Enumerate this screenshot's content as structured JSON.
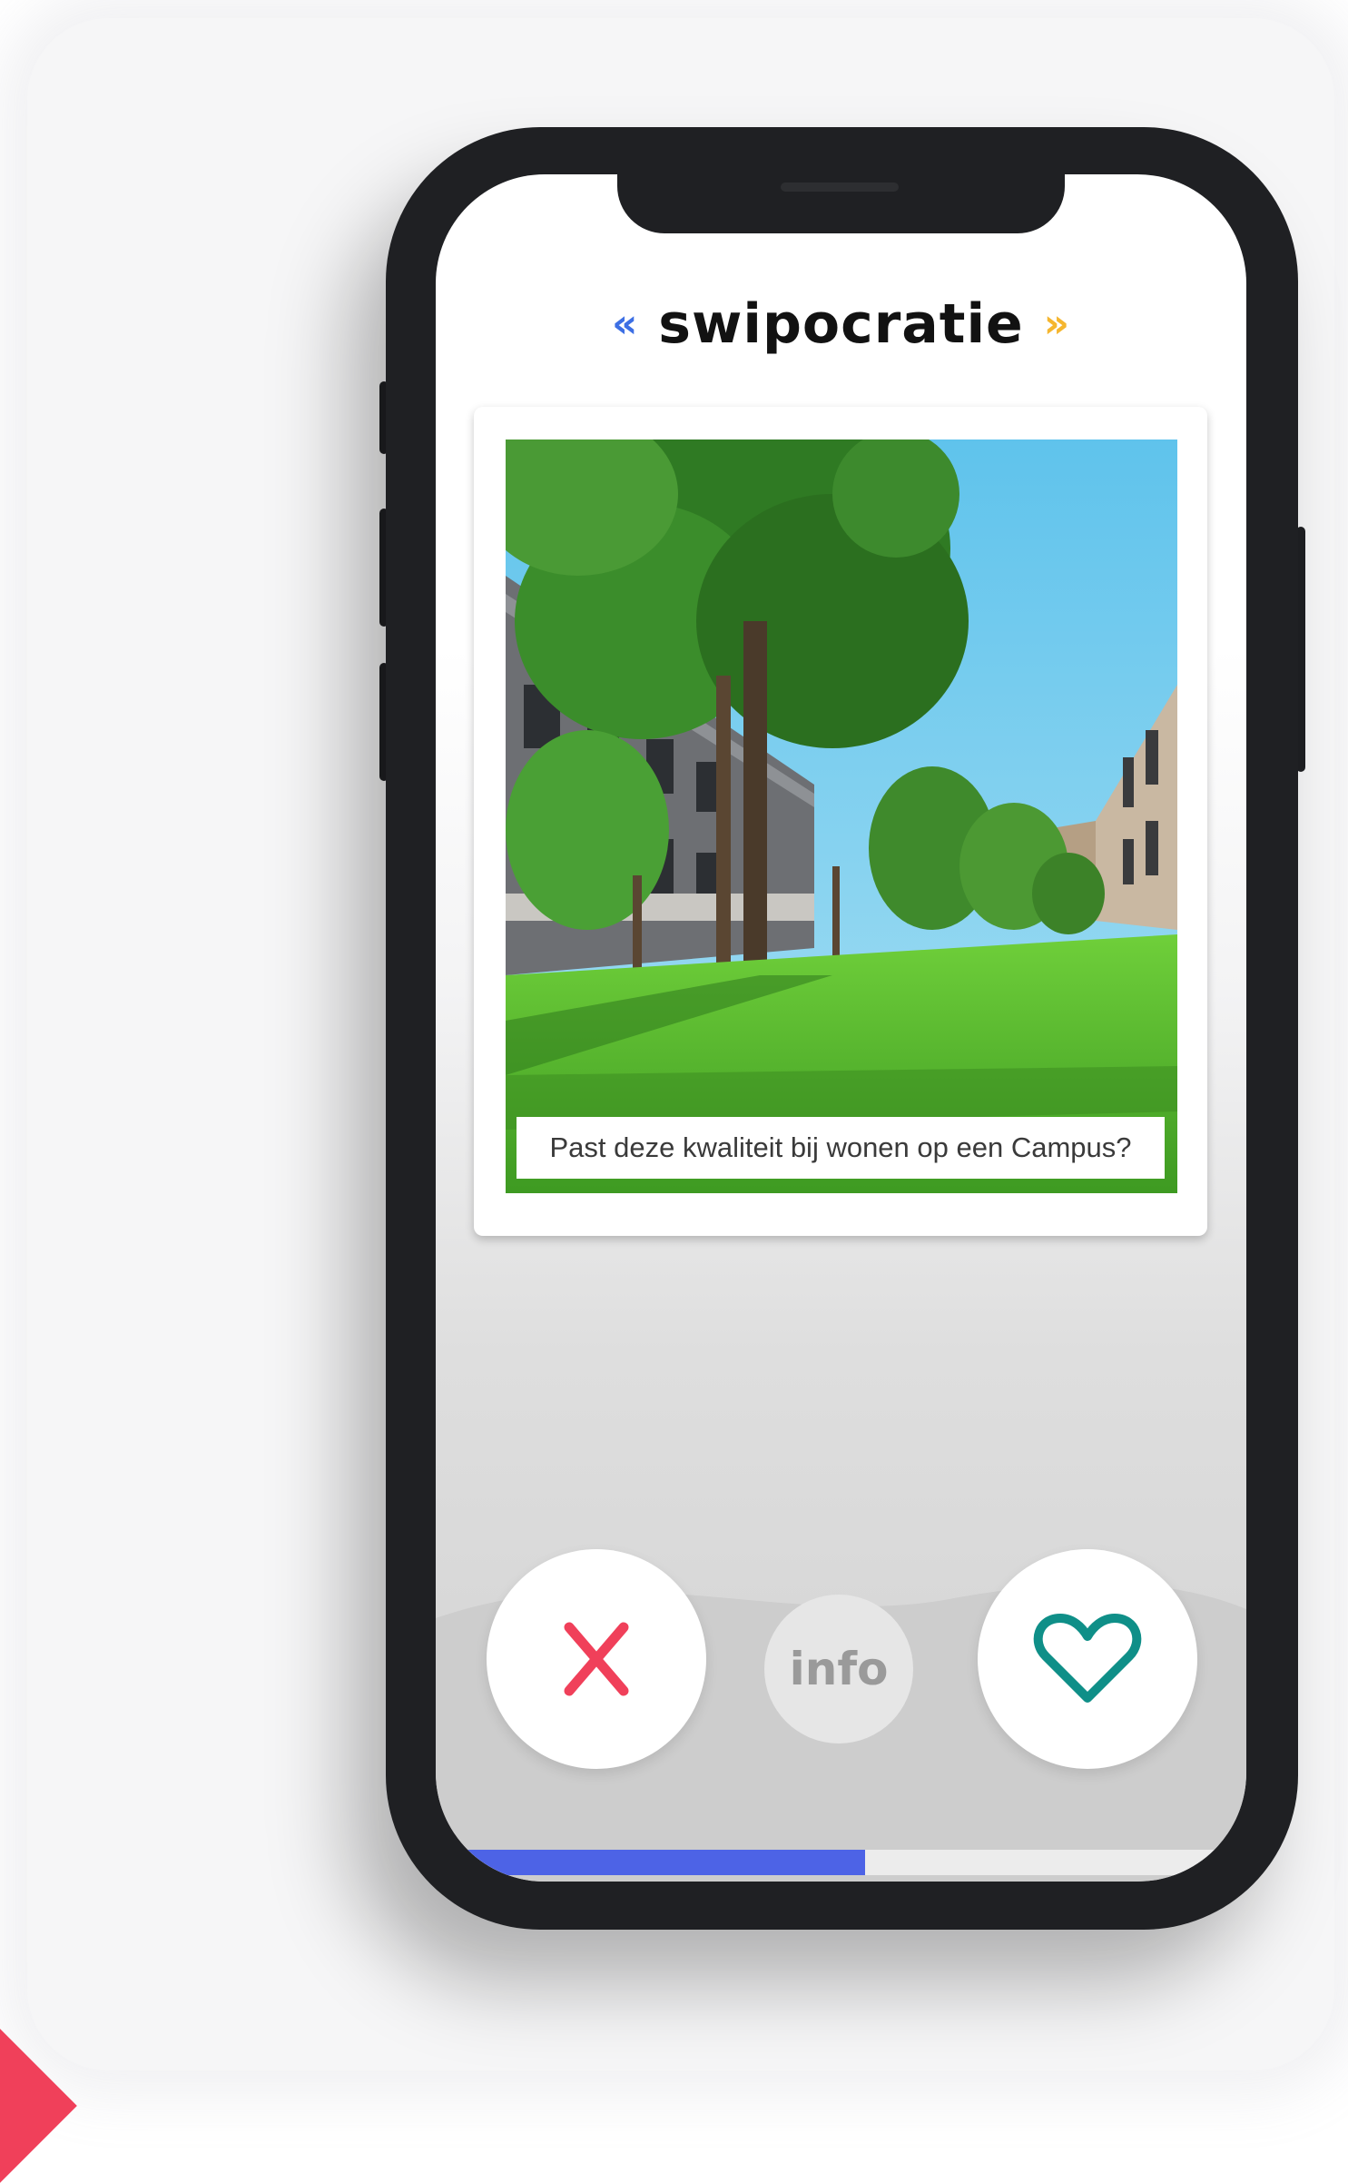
{
  "app": {
    "title": "swipocratie",
    "quote_left": "«",
    "quote_right": "»",
    "quote_left_color": "#3d6fe4",
    "quote_right_color": "#f5b62f"
  },
  "card": {
    "image": "campus-lawn-trees-photo",
    "caption": "Past deze kwaliteit bij wonen op een Campus?"
  },
  "actions": {
    "dislike": {
      "icon": "close-icon",
      "color": "#f0405a"
    },
    "info": {
      "label": "info"
    },
    "like": {
      "icon": "heart-icon",
      "color": "#0f8f88"
    }
  },
  "progress": {
    "fraction": 0.53,
    "color": "#4d63e6"
  }
}
